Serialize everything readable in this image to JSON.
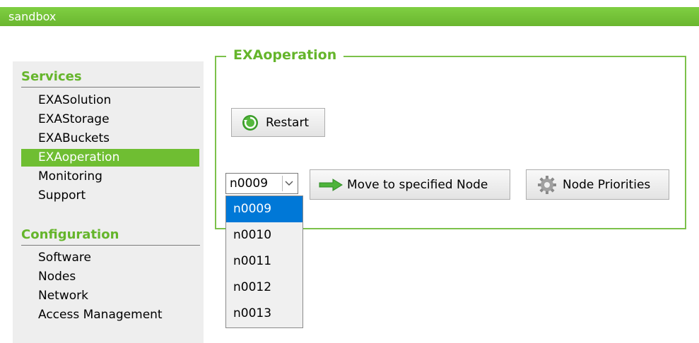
{
  "header": {
    "title": "sandbox"
  },
  "sidebar": {
    "sections": [
      {
        "heading": "Services",
        "items": [
          "EXASolution",
          "EXAStorage",
          "EXABuckets",
          "EXAoperation",
          "Monitoring",
          "Support"
        ],
        "active": "EXAoperation"
      },
      {
        "heading": "Configuration",
        "items": [
          "Software",
          "Nodes",
          "Network",
          "Access Management"
        ]
      }
    ]
  },
  "main": {
    "legend": "EXAoperation",
    "restart_label": "Restart",
    "node_select": {
      "value": "n0009",
      "options": [
        "n0009",
        "n0010",
        "n0011",
        "n0012",
        "n0013"
      ],
      "highlighted": "n0009"
    },
    "move_label": "Move to specified Node",
    "priorities_label": "Node Priorities"
  },
  "colors": {
    "brand_green": "#6fbe32",
    "heading_green": "#65b52b",
    "selection_blue": "#0078d7"
  },
  "icons": {
    "restart": "refresh-icon",
    "move": "arrow-right-icon",
    "priorities": "gear-icon",
    "select": "chevron-down-icon"
  }
}
